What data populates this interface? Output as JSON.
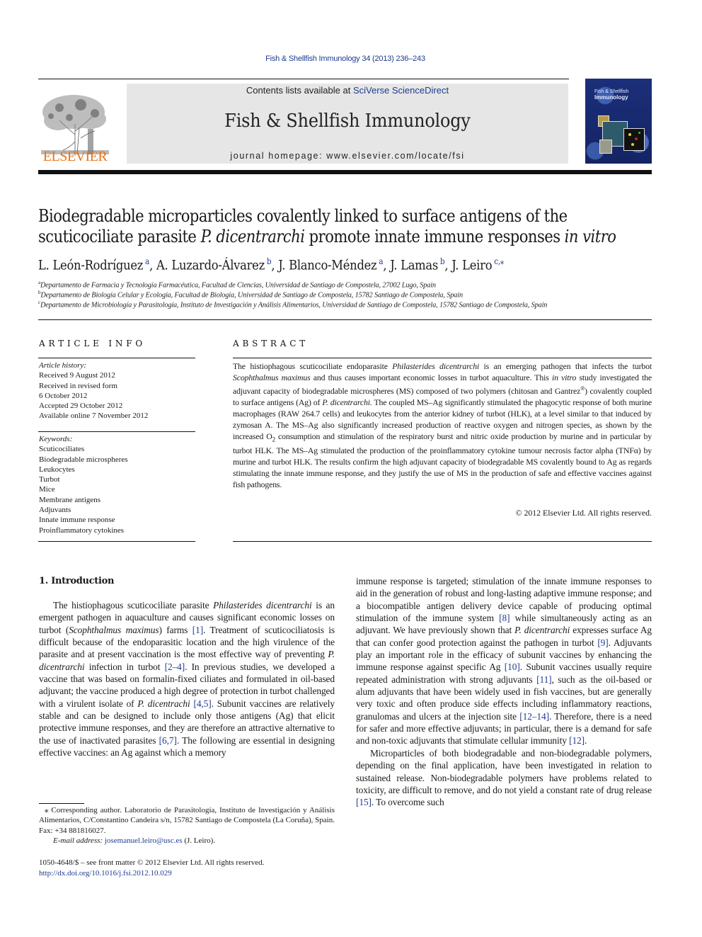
{
  "header": {
    "citation": "Fish & Shellfish Immunology 34 (2013) 236–243",
    "contents_prefix": "Contents lists available at ",
    "contents_link": "SciVerse ScienceDirect",
    "journal_title": "Fish & Shellfish Immunology",
    "homepage": "journal homepage: www.elsevier.com/locate/fsi",
    "publisher": "ELSEVIER",
    "cover_title_line1": "Fish & Shellfish",
    "cover_title_line2": "Immunology",
    "colors": {
      "link": "#1f3b8f",
      "elsevier_orange": "#e8751a",
      "banner_gray": "#e6e6e6",
      "cover_blue": "#1b2f7a"
    }
  },
  "article": {
    "title_part1": "Biodegradable microparticles covalently linked to surface antigens of the scuticociliate parasite ",
    "title_italic1": "P. dicentrarchi",
    "title_part2": " promote innate immune responses ",
    "title_italic2": "in vitro",
    "authors": [
      {
        "name": "L. León-Rodríguez",
        "sup": "a",
        "sep": ", "
      },
      {
        "name": "A. Luzardo-Álvarez",
        "sup": "b",
        "sep": ", "
      },
      {
        "name": "J. Blanco-Méndez",
        "sup": "a",
        "sep": ", "
      },
      {
        "name": "J. Lamas",
        "sup": "b",
        "sep": ", "
      },
      {
        "name": "J. Leiro",
        "sup": "c,⁎",
        "sep": ""
      }
    ],
    "affiliations": [
      {
        "sup": "a",
        "text": "Departamento de Farmacia y Tecnología Farmacéutica, Facultad de Ciencias, Universidad de Santiago de Compostela, 27002 Lugo, Spain"
      },
      {
        "sup": "b",
        "text": "Departamento de Biología Celular y Ecología, Facultad de Biología, Universidad de Santiago de Compostela, 15782 Santiago de Compostela, Spain"
      },
      {
        "sup": "c",
        "text": "Departamento de Microbiología y Parasitología, Instituto de Investigación y Análisis Alimentarios, Universidad de Santiago de Compostela, 15782 Santiago de Compostela, Spain"
      }
    ]
  },
  "article_info": {
    "caption": "ARTICLE INFO",
    "history_heading": "Article history:",
    "history": [
      "Received 9 August 2012",
      "Received in revised form",
      "6 October 2012",
      "Accepted 29 October 2012",
      "Available online 7 November 2012"
    ],
    "keywords_heading": "Keywords:",
    "keywords": [
      "Scuticociliates",
      "Biodegradable microspheres",
      "Leukocytes",
      "Turbot",
      "Mice",
      "Membrane antigens",
      "Adjuvants",
      "Innate immune response",
      "Proinflammatory cytokines"
    ]
  },
  "abstract": {
    "caption": "ABSTRACT",
    "segments": [
      {
        "t": "The histiophagous scuticociliate endoparasite "
      },
      {
        "t": "Philasterides dicentrarchi",
        "i": true
      },
      {
        "t": " is an emerging pathogen that infects the turbot "
      },
      {
        "t": "Scophthalmus maximus",
        "i": true
      },
      {
        "t": " and thus causes important economic losses in turbot aqua­culture. This "
      },
      {
        "t": "in vitro",
        "i": true
      },
      {
        "t": " study investigated the adjuvant capacity of biodegradable microspheres (MS) composed of two polymers (chitosan and Gantrez"
      },
      {
        "t": "®",
        "sup": true
      },
      {
        "t": ") covalently coupled to surface antigens (Ag) of "
      },
      {
        "t": "P. dicentrarchi.",
        "i": true
      },
      {
        "t": " The coupled MS–Ag significantly stimulated the phagocytic response of both murine macrophages (RAW 264.7 cells) and leukocytes from the anterior kidney of turbot (HLK), at a level similar to that induced by zymosan A. The MS–Ag also significantly increased production of reactive oxygen and nitrogen species, as shown by the increased O"
      },
      {
        "t": "2",
        "sub": true
      },
      {
        "t": " consumption and stimulation of the respiratory burst and nitric oxide production by murine and in particular by turbot HLK. The MS–Ag stimulated the production of the proinflammatory cytokine tumour necrosis factor alpha (TNFα) by murine and turbot HLK. The results confirm the high adjuvant capacity of biodegradable MS covalently bound to Ag as regards stimulating the innate immune response, and they justify the use of MS in the production of safe and effective vaccines against fish pathogens."
      }
    ],
    "copyright": "© 2012 Elsevier Ltd. All rights reserved."
  },
  "introduction": {
    "heading": "1.  Introduction",
    "left_paragraphs": [
      [
        {
          "t": "The histiophagous scuticociliate parasite "
        },
        {
          "t": "Philasterides dicen­trarchi",
          "i": true
        },
        {
          "t": " is an emergent pathogen in aquaculture and causes signifi­cant economic losses on turbot ("
        },
        {
          "t": "Scophthalmus maximus",
          "i": true
        },
        {
          "t": ") farms "
        },
        {
          "t": "[1]",
          "ref": true
        },
        {
          "t": ". Treatment of scuticociliatosis is difficult because of the endopara­sitic location and the high virulence of the parasite and at present vaccination is the most effective way of preventing "
        },
        {
          "t": "P. dicentrarchi",
          "i": true
        },
        {
          "t": " infection in turbot "
        },
        {
          "t": "[2–4]",
          "ref": true
        },
        {
          "t": ". In previous studies, we developed a vaccine that was based on formalin-fixed ciliates and formulated in oil-based adjuvant; the vaccine produced a high degree of protection in turbot challenged with a virulent isolate of "
        },
        {
          "t": "P. dicen­trachi",
          "i": true
        },
        {
          "t": " "
        },
        {
          "t": "[4,5]",
          "ref": true
        },
        {
          "t": ". Subunit vaccines are relatively stable and can be designed to include only those antigens (Ag) that elicit protective immune responses, and they are therefore an attractive alternative to the use of inactivated parasites "
        },
        {
          "t": "[6,7]",
          "ref": true
        },
        {
          "t": ". The following are essential in designing effective vaccines: an Ag against which a memory"
        }
      ]
    ],
    "right_paragraphs": [
      [
        {
          "t": "immune response is targeted; stimulation of the innate immune responses to aid in the generation of robust and long-lasting adaptive immune response; and a biocompatible antigen delivery device capable of producing optimal stimulation of the immune system "
        },
        {
          "t": "[8]",
          "ref": true
        },
        {
          "t": " while simultaneously acting as an adjuvant. We have previously shown that "
        },
        {
          "t": "P. dicentrarchi",
          "i": true
        },
        {
          "t": " expresses surface Ag that can confer good protection against the pathogen in turbot "
        },
        {
          "t": "[9]",
          "ref": true
        },
        {
          "t": ". Adju­vants play an important role in the efficacy of subunit vaccines by enhancing the immune response against specific Ag "
        },
        {
          "t": "[10]",
          "ref": true
        },
        {
          "t": ". Subunit vaccines usually require repeated administration with strong adjuvants "
        },
        {
          "t": "[11]",
          "ref": true
        },
        {
          "t": ", such as the oil-based or alum adjuvants that have been widely used in fish vaccines, but are generally very toxic and often produce side effects including inflammatory reactions, granulomas and ulcers at the injection site "
        },
        {
          "t": "[12–14]",
          "ref": true
        },
        {
          "t": ". Therefore, there is a need for safer and more effective adjuvants; in particular, there is a demand for safe and non-toxic adjuvants that stimulate cellular immunity "
        },
        {
          "t": "[12]",
          "ref": true
        },
        {
          "t": "."
        }
      ],
      [
        {
          "t": "Microparticles of both biodegradable and non-biodegradable polymers, depending on the final application, have been investi­gated in relation to sustained release. Non-biodegradable polymers have problems related to toxicity, are difficult to remove, and do not yield a constant rate of drug release "
        },
        {
          "t": "[15]",
          "ref": true
        },
        {
          "t": ". To overcome such"
        }
      ]
    ]
  },
  "footnote": {
    "corresponding": "⁎ Corresponding author. Laboratorio de Parasitología, Instituto de Investigación y Análisis Alimentarios, C/Constantino Candeira s/n, 15782 Santiago de Compostela (La Coruña), Spain. Fax: +34 881816027.",
    "email_label": "E-mail address: ",
    "email": "josemanuel.leiro@usc.es",
    "email_suffix": " (J. Leiro).",
    "front_matter": "1050-4648/$ – see front matter © 2012 Elsevier Ltd. All rights reserved.",
    "doi": "http://dx.doi.org/10.1016/j.fsi.2012.10.029"
  }
}
